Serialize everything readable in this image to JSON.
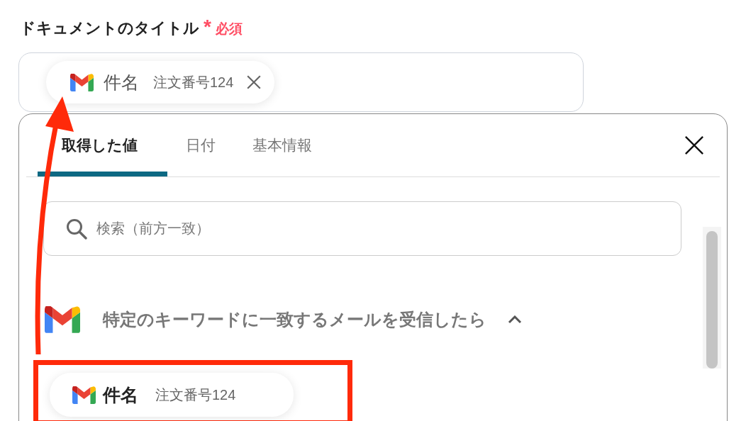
{
  "field": {
    "label": "ドキュメントのタイトル",
    "required_mark": "*",
    "required_text": "必須",
    "chips": [
      {
        "name": "件名",
        "value": "注文番号124"
      }
    ]
  },
  "panel": {
    "tabs": [
      {
        "label": "取得した値",
        "selected": true
      },
      {
        "label": "日付",
        "selected": false
      },
      {
        "label": "基本情報",
        "selected": false
      }
    ],
    "search": {
      "placeholder": "検索（前方一致）"
    },
    "groups": [
      {
        "title": "特定のキーワードに一致するメールを受信したら",
        "expanded": true,
        "items": [
          {
            "name": "件名",
            "value": "注文番号124",
            "highlighted": true
          }
        ]
      }
    ]
  }
}
